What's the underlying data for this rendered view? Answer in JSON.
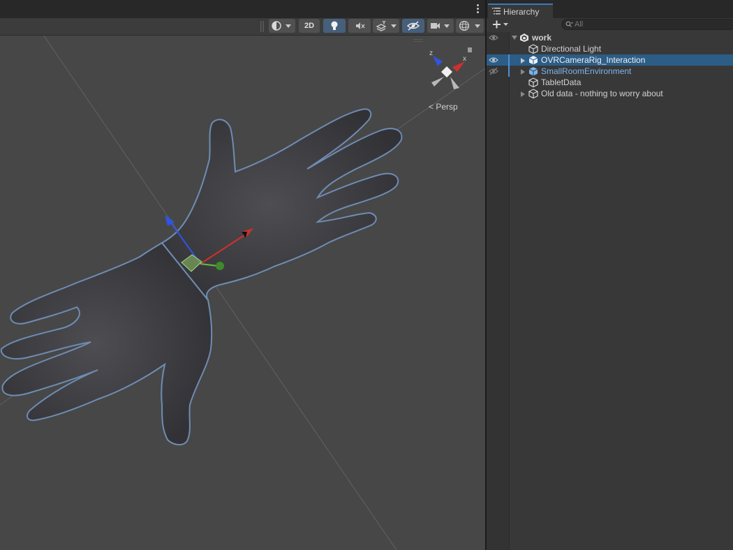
{
  "scene": {
    "toolbar": {
      "mode_2d_label": "2D",
      "icons": [
        "shading-mode-icon",
        "lighting-icon",
        "audio-mute-icon",
        "effects-icon",
        "hidden-objects-icon",
        "camera-icon",
        "gizmos-icon"
      ]
    },
    "gizmo": {
      "axis_z_label": "z",
      "axis_x_label": "x",
      "projection_label": "Persp"
    },
    "colors": {
      "background": "#474747",
      "toolbar_active": "#46607c",
      "outline": "#6f8cb4",
      "axis_x": "#d0302b",
      "axis_y": "#60c040",
      "axis_z": "#3055e0"
    }
  },
  "hierarchy": {
    "tab_label": "Hierarchy",
    "search": {
      "placeholder": "All",
      "value": ""
    },
    "items": [
      {
        "label": "work",
        "type": "scene",
        "expanded": true,
        "bold": true,
        "visibility_icon": "eye-icon"
      },
      {
        "label": "Directional Light",
        "type": "gameobject"
      },
      {
        "label": "OVRCameraRig_Interaction",
        "type": "prefab",
        "selected": true,
        "has_children": true,
        "visibility_icon": "eye-icon"
      },
      {
        "label": "SmallRoomEnvironment",
        "type": "prefab",
        "has_children": true,
        "visibility_icon": "eye-hidden-icon"
      },
      {
        "label": "TabletData",
        "type": "gameobject"
      },
      {
        "label": "Old data - nothing to worry about",
        "type": "gameobject",
        "has_children": true
      }
    ]
  }
}
